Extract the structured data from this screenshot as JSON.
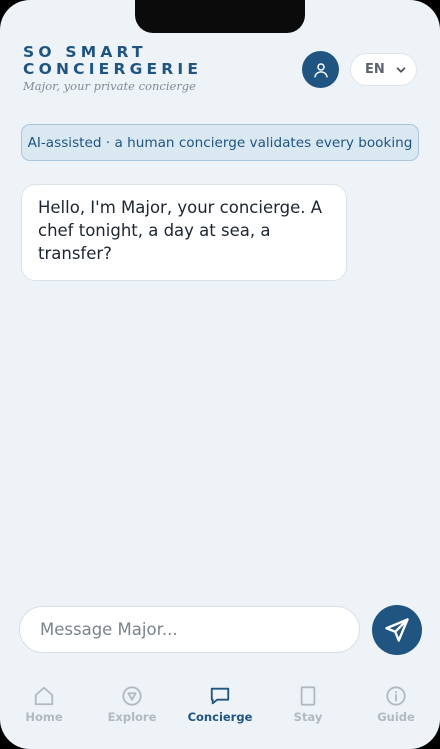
{
  "header": {
    "brand_line1": "SO SMART",
    "brand_line2": "CONCIERGERIE",
    "tagline": "Major, your private concierge",
    "profile_icon": "user-icon",
    "language": "EN",
    "language_icon": "chevron-down-icon"
  },
  "banner": {
    "text": "AI-assisted · a human concierge validates every booking"
  },
  "messages": [
    {
      "from": "assistant",
      "text": "Hello, I'm Major, your concierge. A chef tonight, a day at sea, a transfer?"
    }
  ],
  "composer": {
    "placeholder": "Message Major...",
    "value": "",
    "send_icon": "send-icon"
  },
  "tabs": [
    {
      "label": "Home",
      "icon": "home-icon",
      "active": false
    },
    {
      "label": "Explore",
      "icon": "compass-icon",
      "active": false
    },
    {
      "label": "Concierge",
      "icon": "chat-bubble-icon",
      "active": true
    },
    {
      "label": "Stay",
      "icon": "door-icon",
      "active": false
    },
    {
      "label": "Guide",
      "icon": "info-icon",
      "active": false
    }
  ],
  "colors": {
    "primary": "#1f5580",
    "background": "#eef3f8",
    "inactive_tab": "#b2b9c1"
  }
}
